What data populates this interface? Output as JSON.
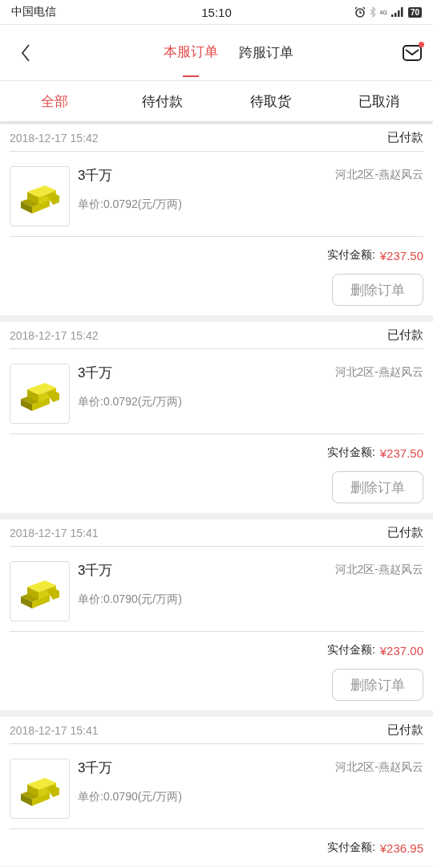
{
  "status_bar": {
    "carrier": "中国电信",
    "time": "15:10",
    "network": "4G",
    "battery": "70"
  },
  "header": {
    "tabs": [
      {
        "label": "本服订单",
        "selected": true
      },
      {
        "label": "跨服订单",
        "selected": false
      }
    ],
    "mail_unread": true
  },
  "filters": [
    {
      "label": "全部",
      "selected": true
    },
    {
      "label": "待付款",
      "selected": false
    },
    {
      "label": "待取货",
      "selected": false
    },
    {
      "label": "已取消",
      "selected": false
    }
  ],
  "orders": [
    {
      "time": "2018-12-17 15:42",
      "status": "已付款",
      "title": "3千万",
      "unit_price": "单价:0.0792(元/万两)",
      "server": "河北2区-燕赵风云",
      "total_label": "实付金额:",
      "total": "¥237.50",
      "button": "删除订单"
    },
    {
      "time": "2018-12-17 15:42",
      "status": "已付款",
      "title": "3千万",
      "unit_price": "单价:0.0792(元/万两)",
      "server": "河北2区-燕赵风云",
      "total_label": "实付金额:",
      "total": "¥237.50",
      "button": "删除订单"
    },
    {
      "time": "2018-12-17 15:41",
      "status": "已付款",
      "title": "3千万",
      "unit_price": "单价:0.0790(元/万两)",
      "server": "河北2区-燕赵风云",
      "total_label": "实付金额:",
      "total": "¥237.00",
      "button": "删除订单"
    },
    {
      "time": "2018-12-17 15:41",
      "status": "已付款",
      "title": "3千万",
      "unit_price": "单价:0.0790(元/万两)",
      "server": "河北2区-燕赵风云",
      "total_label": "实付金额:",
      "total": "¥236.95"
    }
  ]
}
